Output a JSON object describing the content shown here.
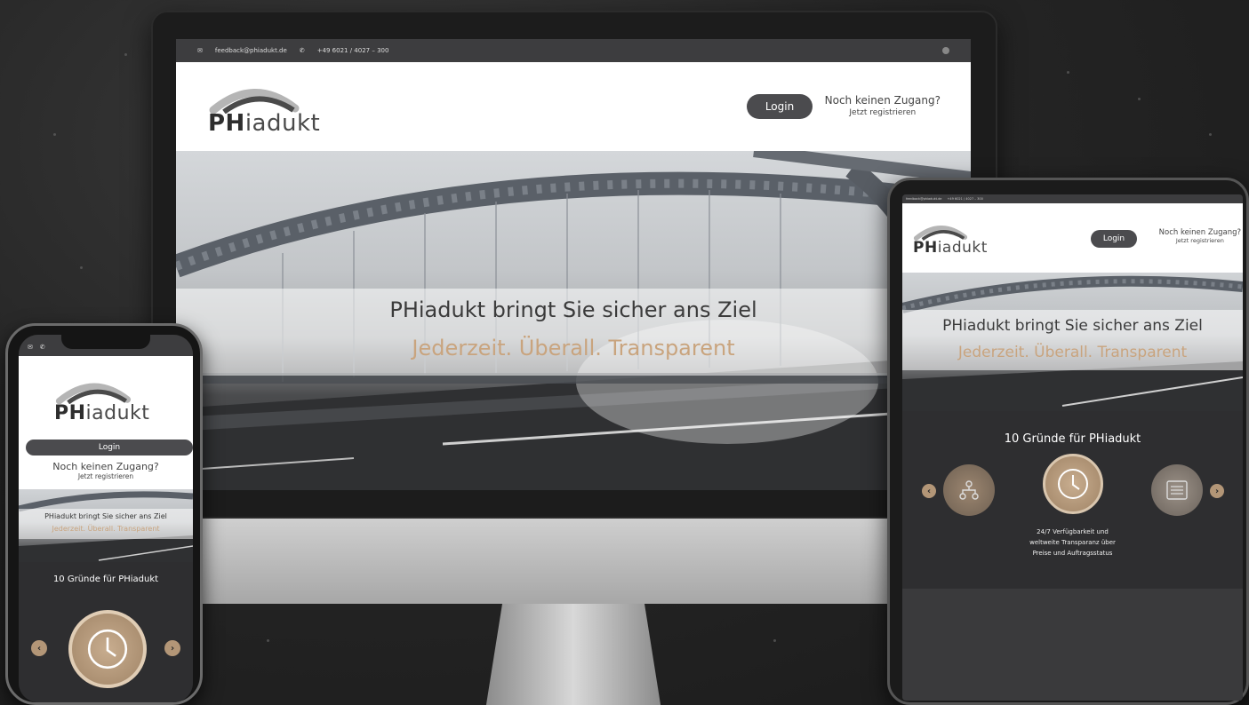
{
  "desktop": {
    "topbar": {
      "email": "feedback@phiadukt.de",
      "phone": "+49 6021 / 4027 – 300"
    },
    "logo": {
      "bold": "PH",
      "rest": "iadukt"
    },
    "login": "Login",
    "no_access": "Noch keinen Zugang?",
    "register": "Jetzt registrieren",
    "hero_title": "PHiadukt bringt Sie sicher ans Ziel",
    "hero_subtitle": "Jederzeit. Überall. Transparent"
  },
  "tablet": {
    "topbar": {
      "email": "feedback@phiadukt.de",
      "phone": "+49 6021 / 4027 – 300"
    },
    "logo": {
      "bold": "PH",
      "rest": "iadukt"
    },
    "login": "Login",
    "no_access": "Noch keinen Zugang?",
    "register": "Jetzt registrieren",
    "hero_title": "PHiadukt bringt Sie sicher ans Ziel",
    "hero_subtitle": "Jederzeit. Überall. Transparent",
    "reasons_title": "10 Gründe für PHiadukt",
    "reason_text_line1": "24/7 Verfügbarkeit und",
    "reason_text_line2": "weltweite Transparanz über",
    "reason_text_line3": "Preise und Auftragsstatus"
  },
  "phone": {
    "logo": {
      "bold": "PH",
      "rest": "iadukt"
    },
    "login": "Login",
    "no_access": "Noch keinen Zugang?",
    "register": "Jetzt registrieren",
    "hero_title": "PHiadukt bringt Sie sicher ans Ziel",
    "hero_subtitle": "Jederzeit. Überall. Transparent",
    "reasons_title": "10 Gründe für PHiadukt"
  },
  "icons": {
    "arrow_left": "‹",
    "arrow_right": "›",
    "network": "network-icon",
    "clock": "clock-icon",
    "list": "list-icon"
  },
  "colors": {
    "accent_gold": "#c9a47e",
    "dark_bg": "#2e2e30",
    "button_dark": "#4b4b4e"
  }
}
